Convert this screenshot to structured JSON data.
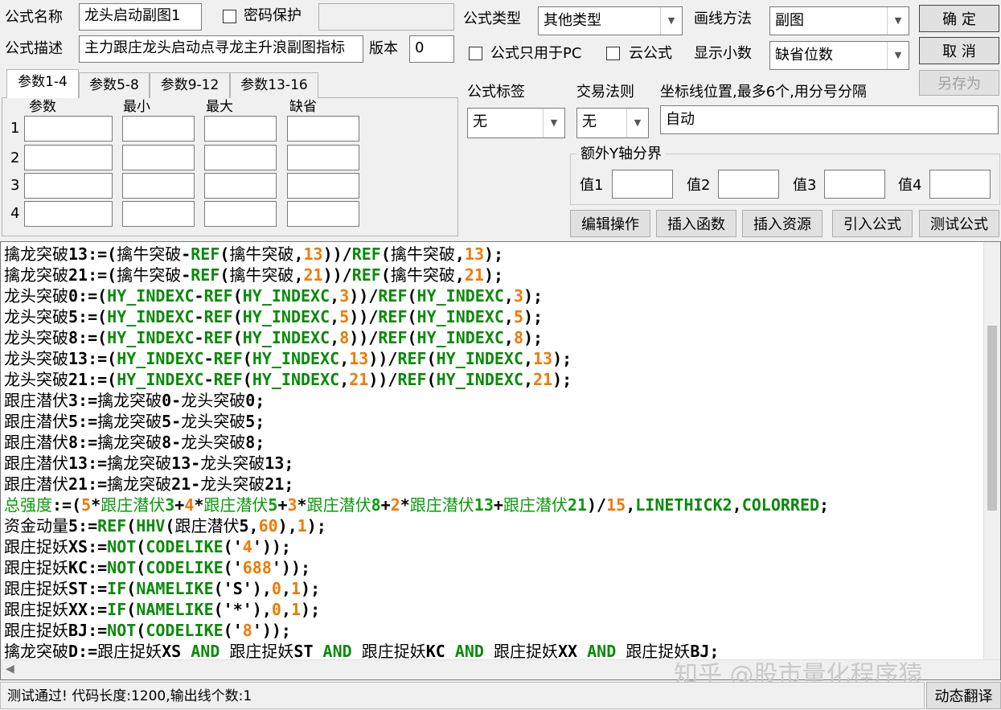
{
  "form": {
    "name_label": "公式名称",
    "name_value": "龙头启动副图1",
    "password_label": "密码保护",
    "desc_label": "公式描述",
    "desc_value": "主力跟庄龙头启动点寻龙主升浪副图指标",
    "version_label": "版本",
    "version_value": "0",
    "type_label": "公式类型",
    "type_value": "其他类型",
    "draw_label": "画线方法",
    "draw_value": "副图",
    "pc_only_label": "公式只用于PC",
    "cloud_label": "云公式",
    "decimals_label": "显示小数",
    "decimals_value": "缺省位数",
    "tag_label": "公式标签",
    "tag_value": "无",
    "rule_label": "交易法则",
    "rule_value": "无",
    "axis_label": "坐标线位置,最多6个,用分号分隔",
    "axis_value": "自动",
    "extra_y_label": "额外Y轴分界",
    "val1": "值1",
    "val2": "值2",
    "val3": "值3",
    "val4": "值4"
  },
  "buttons": {
    "ok": "确 定",
    "cancel": "取 消",
    "save_as": "另存为",
    "edit_ops": "编辑操作",
    "insert_func": "插入函数",
    "insert_res": "插入资源",
    "import_formula": "引入公式",
    "test_formula": "测试公式",
    "dynamic_translate": "动态翻译"
  },
  "tabs": [
    "参数1-4",
    "参数5-8",
    "参数9-12",
    "参数13-16"
  ],
  "params": {
    "headers": [
      "参数",
      "最小",
      "最大",
      "缺省"
    ],
    "rows": [
      "1",
      "2",
      "3",
      "4"
    ]
  },
  "code_lines": [
    [
      [
        "cn",
        "擒龙突破"
      ],
      [
        "t",
        "13:=("
      ],
      [
        "cn",
        "擒牛突破"
      ],
      [
        "t",
        "-"
      ],
      [
        "fn",
        "REF"
      ],
      [
        "t",
        "("
      ],
      [
        "cn",
        "擒牛突破"
      ],
      [
        "t",
        ","
      ],
      [
        "num",
        "13"
      ],
      [
        "t",
        "))/"
      ],
      [
        "fn",
        "REF"
      ],
      [
        "t",
        "("
      ],
      [
        "cn",
        "擒牛突破"
      ],
      [
        "t",
        ","
      ],
      [
        "num",
        "13"
      ],
      [
        "t",
        ");"
      ]
    ],
    [
      [
        "cn",
        "擒龙突破"
      ],
      [
        "t",
        "21:=("
      ],
      [
        "cn",
        "擒牛突破"
      ],
      [
        "t",
        "-"
      ],
      [
        "fn",
        "REF"
      ],
      [
        "t",
        "("
      ],
      [
        "cn",
        "擒牛突破"
      ],
      [
        "t",
        ","
      ],
      [
        "num",
        "21"
      ],
      [
        "t",
        "))/"
      ],
      [
        "fn",
        "REF"
      ],
      [
        "t",
        "("
      ],
      [
        "cn",
        "擒牛突破"
      ],
      [
        "t",
        ","
      ],
      [
        "num",
        "21"
      ],
      [
        "t",
        ");"
      ]
    ],
    [
      [
        "cn",
        "龙头突破"
      ],
      [
        "t",
        "0:=("
      ],
      [
        "fn",
        "HY_INDEXC"
      ],
      [
        "t",
        "-"
      ],
      [
        "fn",
        "REF"
      ],
      [
        "t",
        "("
      ],
      [
        "fn",
        "HY_INDEXC"
      ],
      [
        "t",
        ","
      ],
      [
        "num",
        "3"
      ],
      [
        "t",
        "))/"
      ],
      [
        "fn",
        "REF"
      ],
      [
        "t",
        "("
      ],
      [
        "fn",
        "HY_INDEXC"
      ],
      [
        "t",
        ","
      ],
      [
        "num",
        "3"
      ],
      [
        "t",
        ");"
      ]
    ],
    [
      [
        "cn",
        "龙头突破"
      ],
      [
        "t",
        "5:=("
      ],
      [
        "fn",
        "HY_INDEXC"
      ],
      [
        "t",
        "-"
      ],
      [
        "fn",
        "REF"
      ],
      [
        "t",
        "("
      ],
      [
        "fn",
        "HY_INDEXC"
      ],
      [
        "t",
        ","
      ],
      [
        "num",
        "5"
      ],
      [
        "t",
        "))/"
      ],
      [
        "fn",
        "REF"
      ],
      [
        "t",
        "("
      ],
      [
        "fn",
        "HY_INDEXC"
      ],
      [
        "t",
        ","
      ],
      [
        "num",
        "5"
      ],
      [
        "t",
        ");"
      ]
    ],
    [
      [
        "cn",
        "龙头突破"
      ],
      [
        "t",
        "8:=("
      ],
      [
        "fn",
        "HY_INDEXC"
      ],
      [
        "t",
        "-"
      ],
      [
        "fn",
        "REF"
      ],
      [
        "t",
        "("
      ],
      [
        "fn",
        "HY_INDEXC"
      ],
      [
        "t",
        ","
      ],
      [
        "num",
        "8"
      ],
      [
        "t",
        "))/"
      ],
      [
        "fn",
        "REF"
      ],
      [
        "t",
        "("
      ],
      [
        "fn",
        "HY_INDEXC"
      ],
      [
        "t",
        ","
      ],
      [
        "num",
        "8"
      ],
      [
        "t",
        ");"
      ]
    ],
    [
      [
        "cn",
        "龙头突破"
      ],
      [
        "t",
        "13:=("
      ],
      [
        "fn",
        "HY_INDEXC"
      ],
      [
        "t",
        "-"
      ],
      [
        "fn",
        "REF"
      ],
      [
        "t",
        "("
      ],
      [
        "fn",
        "HY_INDEXC"
      ],
      [
        "t",
        ","
      ],
      [
        "num",
        "13"
      ],
      [
        "t",
        "))/"
      ],
      [
        "fn",
        "REF"
      ],
      [
        "t",
        "("
      ],
      [
        "fn",
        "HY_INDEXC"
      ],
      [
        "t",
        ","
      ],
      [
        "num",
        "13"
      ],
      [
        "t",
        ");"
      ]
    ],
    [
      [
        "cn",
        "龙头突破"
      ],
      [
        "t",
        "21:=("
      ],
      [
        "fn",
        "HY_INDEXC"
      ],
      [
        "t",
        "-"
      ],
      [
        "fn",
        "REF"
      ],
      [
        "t",
        "("
      ],
      [
        "fn",
        "HY_INDEXC"
      ],
      [
        "t",
        ","
      ],
      [
        "num",
        "21"
      ],
      [
        "t",
        "))/"
      ],
      [
        "fn",
        "REF"
      ],
      [
        "t",
        "("
      ],
      [
        "fn",
        "HY_INDEXC"
      ],
      [
        "t",
        ","
      ],
      [
        "num",
        "21"
      ],
      [
        "t",
        ");"
      ]
    ],
    [
      [
        "cn",
        "跟庄潜伏"
      ],
      [
        "t",
        "3:="
      ],
      [
        "cn",
        "擒龙突破"
      ],
      [
        "t",
        "0-"
      ],
      [
        "cn",
        "龙头突破"
      ],
      [
        "t",
        "0;"
      ]
    ],
    [
      [
        "cn",
        "跟庄潜伏"
      ],
      [
        "t",
        "5:="
      ],
      [
        "cn",
        "擒龙突破"
      ],
      [
        "t",
        "5-"
      ],
      [
        "cn",
        "龙头突破"
      ],
      [
        "t",
        "5;"
      ]
    ],
    [
      [
        "cn",
        "跟庄潜伏"
      ],
      [
        "t",
        "8:="
      ],
      [
        "cn",
        "擒龙突破"
      ],
      [
        "t",
        "8-"
      ],
      [
        "cn",
        "龙头突破"
      ],
      [
        "t",
        "8;"
      ]
    ],
    [
      [
        "cn",
        "跟庄潜伏"
      ],
      [
        "t",
        "13:="
      ],
      [
        "cn",
        "擒龙突破"
      ],
      [
        "t",
        "13-"
      ],
      [
        "cn",
        "龙头突破"
      ],
      [
        "t",
        "13;"
      ]
    ],
    [
      [
        "cn",
        "跟庄潜伏"
      ],
      [
        "t",
        "21:="
      ],
      [
        "cn",
        "擒龙突破"
      ],
      [
        "t",
        "21-"
      ],
      [
        "cn",
        "龙头突破"
      ],
      [
        "t",
        "21;"
      ]
    ],
    [
      [
        "cng",
        "总强度"
      ],
      [
        "t",
        ":=("
      ],
      [
        "num",
        "5"
      ],
      [
        "t",
        "*"
      ],
      [
        "cng",
        "跟庄潜伏"
      ],
      [
        "g",
        "3"
      ],
      [
        "t",
        "+"
      ],
      [
        "num",
        "4"
      ],
      [
        "t",
        "*"
      ],
      [
        "cng",
        "跟庄潜伏"
      ],
      [
        "g",
        "5"
      ],
      [
        "t",
        "+"
      ],
      [
        "num",
        "3"
      ],
      [
        "t",
        "*"
      ],
      [
        "cng",
        "跟庄潜伏"
      ],
      [
        "g",
        "8"
      ],
      [
        "t",
        "+"
      ],
      [
        "num",
        "2"
      ],
      [
        "t",
        "*"
      ],
      [
        "cng",
        "跟庄潜伏"
      ],
      [
        "g",
        "13"
      ],
      [
        "t",
        "+"
      ],
      [
        "cng",
        "跟庄潜伏"
      ],
      [
        "g",
        "21"
      ],
      [
        "t",
        ")/"
      ],
      [
        "num",
        "15"
      ],
      [
        "t",
        ","
      ],
      [
        "fn",
        "LINETHICK2"
      ],
      [
        "t",
        ","
      ],
      [
        "fn",
        "COLORRED"
      ],
      [
        "t",
        ";"
      ]
    ],
    [
      [
        "cn",
        "资金动量"
      ],
      [
        "t",
        "5:="
      ],
      [
        "fn",
        "REF"
      ],
      [
        "t",
        "("
      ],
      [
        "fn",
        "HHV"
      ],
      [
        "t",
        "("
      ],
      [
        "cn",
        "跟庄潜伏"
      ],
      [
        "t",
        "5,"
      ],
      [
        "num",
        "60"
      ],
      [
        "t",
        "),"
      ],
      [
        "num",
        "1"
      ],
      [
        "t",
        ");"
      ]
    ],
    [
      [
        "cn",
        "跟庄捉妖"
      ],
      [
        "t",
        "XS:="
      ],
      [
        "fn",
        "NOT"
      ],
      [
        "t",
        "("
      ],
      [
        "fn",
        "CODELIKE"
      ],
      [
        "t",
        "('"
      ],
      [
        "num",
        "4"
      ],
      [
        "t",
        "'));"
      ]
    ],
    [
      [
        "cn",
        "跟庄捉妖"
      ],
      [
        "t",
        "KC:="
      ],
      [
        "fn",
        "NOT"
      ],
      [
        "t",
        "("
      ],
      [
        "fn",
        "CODELIKE"
      ],
      [
        "t",
        "('"
      ],
      [
        "num",
        "688"
      ],
      [
        "t",
        "'));"
      ]
    ],
    [
      [
        "cn",
        "跟庄捉妖"
      ],
      [
        "t",
        "ST:="
      ],
      [
        "fn",
        "IF"
      ],
      [
        "t",
        "("
      ],
      [
        "fn",
        "NAMELIKE"
      ],
      [
        "t",
        "('S'),"
      ],
      [
        "num",
        "0"
      ],
      [
        "t",
        ","
      ],
      [
        "num",
        "1"
      ],
      [
        "t",
        ");"
      ]
    ],
    [
      [
        "cn",
        "跟庄捉妖"
      ],
      [
        "t",
        "XX:="
      ],
      [
        "fn",
        "IF"
      ],
      [
        "t",
        "("
      ],
      [
        "fn",
        "NAMELIKE"
      ],
      [
        "t",
        "('*'),"
      ],
      [
        "num",
        "0"
      ],
      [
        "t",
        ","
      ],
      [
        "num",
        "1"
      ],
      [
        "t",
        ");"
      ]
    ],
    [
      [
        "cn",
        "跟庄捉妖"
      ],
      [
        "t",
        "BJ:="
      ],
      [
        "fn",
        "NOT"
      ],
      [
        "t",
        "("
      ],
      [
        "fn",
        "CODELIKE"
      ],
      [
        "t",
        "('"
      ],
      [
        "num",
        "8"
      ],
      [
        "t",
        "'));"
      ]
    ],
    [
      [
        "cn",
        "擒龙突破"
      ],
      [
        "t",
        "D:="
      ],
      [
        "cn",
        "跟庄捉妖"
      ],
      [
        "t",
        "XS "
      ],
      [
        "fn",
        "AND"
      ],
      [
        "t",
        " "
      ],
      [
        "cn",
        "跟庄捉妖"
      ],
      [
        "t",
        "ST "
      ],
      [
        "fn",
        "AND"
      ],
      [
        "t",
        " "
      ],
      [
        "cn",
        "跟庄捉妖"
      ],
      [
        "t",
        "KC "
      ],
      [
        "fn",
        "AND"
      ],
      [
        "t",
        " "
      ],
      [
        "cn",
        "跟庄捉妖"
      ],
      [
        "t",
        "XX "
      ],
      [
        "fn",
        "AND"
      ],
      [
        "t",
        " "
      ],
      [
        "cn",
        "跟庄捉妖"
      ],
      [
        "t",
        "BJ;"
      ]
    ]
  ],
  "status": "测试通过! 代码长度:1200,输出线个数:1",
  "watermark": "知乎 @股市量化程序猿",
  "colors": {
    "function": "#0a8a0a",
    "number": "#f07a00",
    "series_green": "#0a9a0a"
  }
}
